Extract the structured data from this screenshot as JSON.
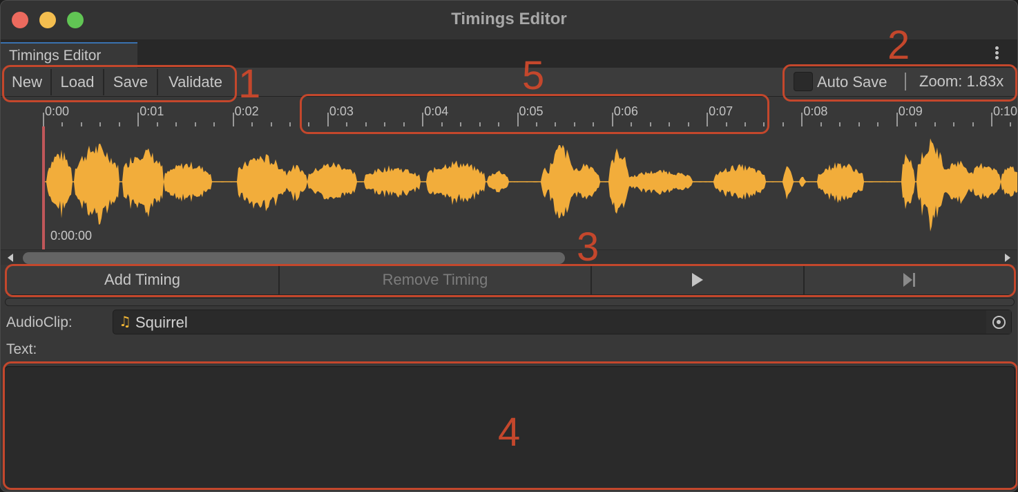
{
  "window": {
    "title": "Timings Editor",
    "tab_label": "Timings Editor"
  },
  "toolbar": {
    "buttons": [
      {
        "label": "New"
      },
      {
        "label": "Load"
      },
      {
        "label": "Save"
      },
      {
        "label": "Validate"
      }
    ],
    "auto_save_label": "Auto Save",
    "auto_save_checked": false,
    "zoom_label": "Zoom: 1.83x"
  },
  "timeline": {
    "ticks": [
      "0:00",
      "0:01",
      "0:02",
      "0:03",
      "0:04",
      "0:05",
      "0:06",
      "0:07",
      "0:08",
      "0:09",
      "0:10"
    ],
    "playhead_time": "0:00:00",
    "waveform_color": "#f2ad3b",
    "playhead_color": "#c0575a"
  },
  "actions": {
    "add_timing": "Add Timing",
    "remove_timing": "Remove Timing",
    "play_icon": "play-icon",
    "skip_icon": "skip-to-end-icon"
  },
  "fields": {
    "audioclip_label": "AudioClip:",
    "audioclip_value": "Squirrel",
    "audioclip_icon": "music-note-icon",
    "text_label": "Text:",
    "text_value": ""
  },
  "annotations": {
    "color": "#c4472c",
    "labels": [
      "1",
      "2",
      "3",
      "4",
      "5"
    ]
  }
}
